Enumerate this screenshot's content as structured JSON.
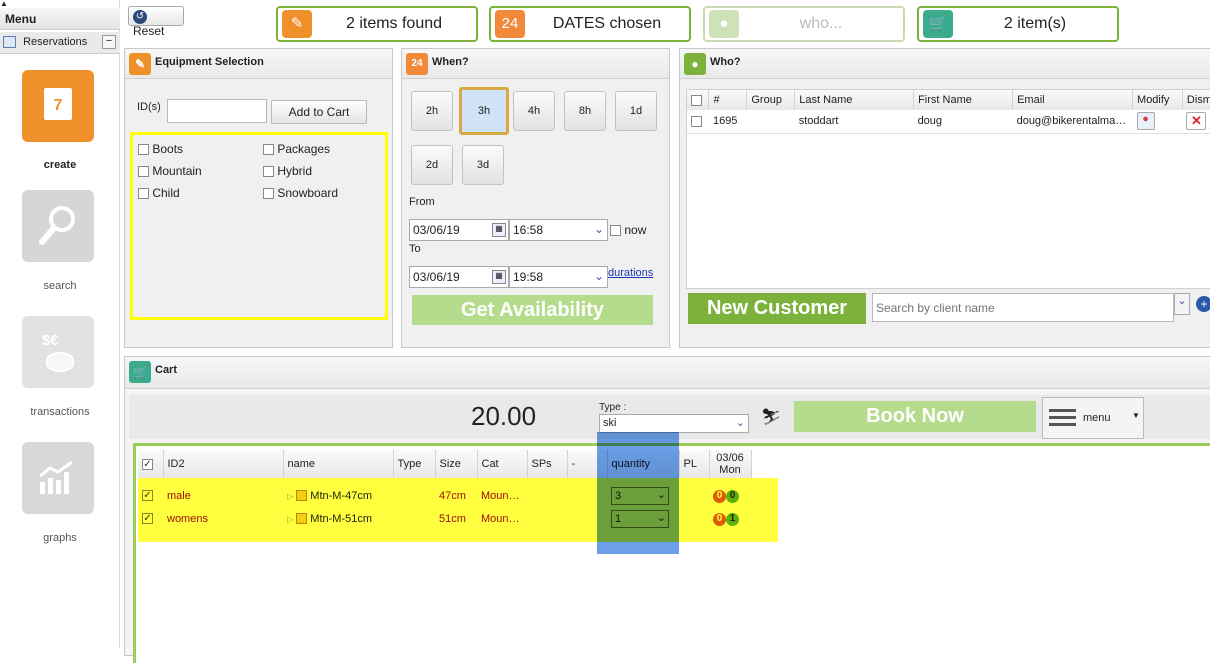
{
  "sidebar": {
    "menu_label": "Menu",
    "reservations_label": "Reservations",
    "collapse_symbol": "−",
    "nav": [
      {
        "label": "create",
        "icon": "calendar-icon",
        "icon_glyph": "7",
        "color": "#f0902a"
      },
      {
        "label": "search",
        "icon": "magnifier-icon",
        "icon_glyph": "⌕",
        "color": "#d6d6d6"
      },
      {
        "label": "transactions",
        "icon": "coins-icon",
        "icon_glyph": "$€",
        "color": "#e2e2e2"
      },
      {
        "label": "graphs",
        "icon": "chart-icon",
        "icon_glyph": "↗",
        "color": "#d8d8d8"
      }
    ]
  },
  "toolbar": {
    "reset_label": "Reset",
    "status": [
      {
        "text": "2 items found",
        "icon": "clipboard-icon",
        "color": "#f0902a",
        "muted": false
      },
      {
        "text": "DATES chosen",
        "icon": "calendar-icon",
        "color": "#f08a3a",
        "muted": false
      },
      {
        "text": "who...",
        "icon": "person-icon",
        "color": "#cde2b8",
        "muted": true
      },
      {
        "text": "2 item(s)",
        "icon": "cart-icon",
        "color": "#3aab8c",
        "muted": false
      }
    ]
  },
  "equipment": {
    "title": "Equipment Selection",
    "ids_label": "ID(s)",
    "ids_value": "",
    "add_to_cart": "Add to Cart",
    "options": [
      "Boots",
      "Packages",
      "Mountain",
      "Hybrid",
      "Child",
      "Snowboard"
    ]
  },
  "when": {
    "title": "When?",
    "durations": [
      "2h",
      "3h",
      "4h",
      "8h",
      "1d",
      "2d",
      "3d"
    ],
    "selected_duration": "3h",
    "from_label": "From",
    "from_date": "03/06/19",
    "from_time": "16:58",
    "now_label": "now",
    "to_label": "To",
    "to_date": "03/06/19",
    "to_time": "19:58",
    "durations_link": "durations",
    "get_availability": "Get Availability"
  },
  "who": {
    "title": "Who?",
    "columns": [
      "#",
      "Group",
      "Last Name",
      "First Name",
      "Email",
      "Modify",
      "Dism"
    ],
    "rows": [
      {
        "num": "1695",
        "group": "",
        "last": "stoddart",
        "first": "doug",
        "email": "doug@bikerentalma…"
      }
    ],
    "new_customer": "New Customer",
    "search_placeholder": "Search by client name"
  },
  "cart": {
    "title": "Cart",
    "total": "20.00",
    "type_label": "Type :",
    "type_value": "ski",
    "book_now": "Book Now",
    "menu_label": "menu",
    "columns": [
      "ID2",
      "name",
      "Type",
      "Size",
      "Cat",
      "SPs",
      "-",
      "quantity",
      "PL"
    ],
    "date_header_line1": "03/06",
    "date_header_line2": "Mon",
    "rows": [
      {
        "id2": "male",
        "name": "Mtn-M-47cm",
        "type": "",
        "size": "47cm",
        "cat": "Moun…",
        "sps": "",
        "qty": "3",
        "pl": "",
        "badge_a": "0",
        "badge_b": "0"
      },
      {
        "id2": "womens",
        "name": "Mtn-M-51cm",
        "type": "",
        "size": "51cm",
        "cat": "Moun…",
        "sps": "",
        "qty": "1",
        "pl": "",
        "badge_a": "0",
        "badge_b": "1"
      }
    ]
  },
  "colors": {
    "accent_green": "#7cb23b",
    "highlight_yellow": "#ffff00",
    "highlight_blue": "#3a7fe0",
    "row_text_red": "#a01010"
  }
}
